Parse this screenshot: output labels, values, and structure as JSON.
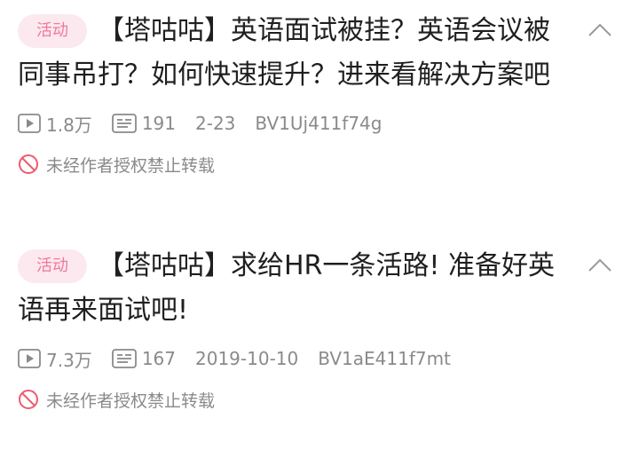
{
  "colors": {
    "accent": "#f2789b",
    "badge_bg": "#fbe9ef",
    "meta_text": "#8a8a8a",
    "title_text": "#1f1f1f",
    "warning": "#ef5b6e"
  },
  "videos": [
    {
      "badge": "活动",
      "title": "【塔咕咕】英语面试被挂？英语会议被同事吊打？如何快速提升？进来看解决方案吧",
      "views": "1.8万",
      "comments": "191",
      "date": "2-23",
      "bvid": "BV1Uj411f74g",
      "copyright_notice": "未经作者授权禁止转载",
      "icons": {
        "views": "play-icon",
        "comments": "danmaku-icon",
        "copyright": "prohibited-icon",
        "collapse": "chevron-up-icon"
      }
    },
    {
      "badge": "活动",
      "title": "【塔咕咕】求给HR一条活路! 准备好英语再来面试吧!",
      "views": "7.3万",
      "comments": "167",
      "date": "2019-10-10",
      "bvid": "BV1aE411f7mt",
      "copyright_notice": "未经作者授权禁止转载",
      "icons": {
        "views": "play-icon",
        "comments": "danmaku-icon",
        "copyright": "prohibited-icon",
        "collapse": "chevron-up-icon"
      }
    }
  ]
}
